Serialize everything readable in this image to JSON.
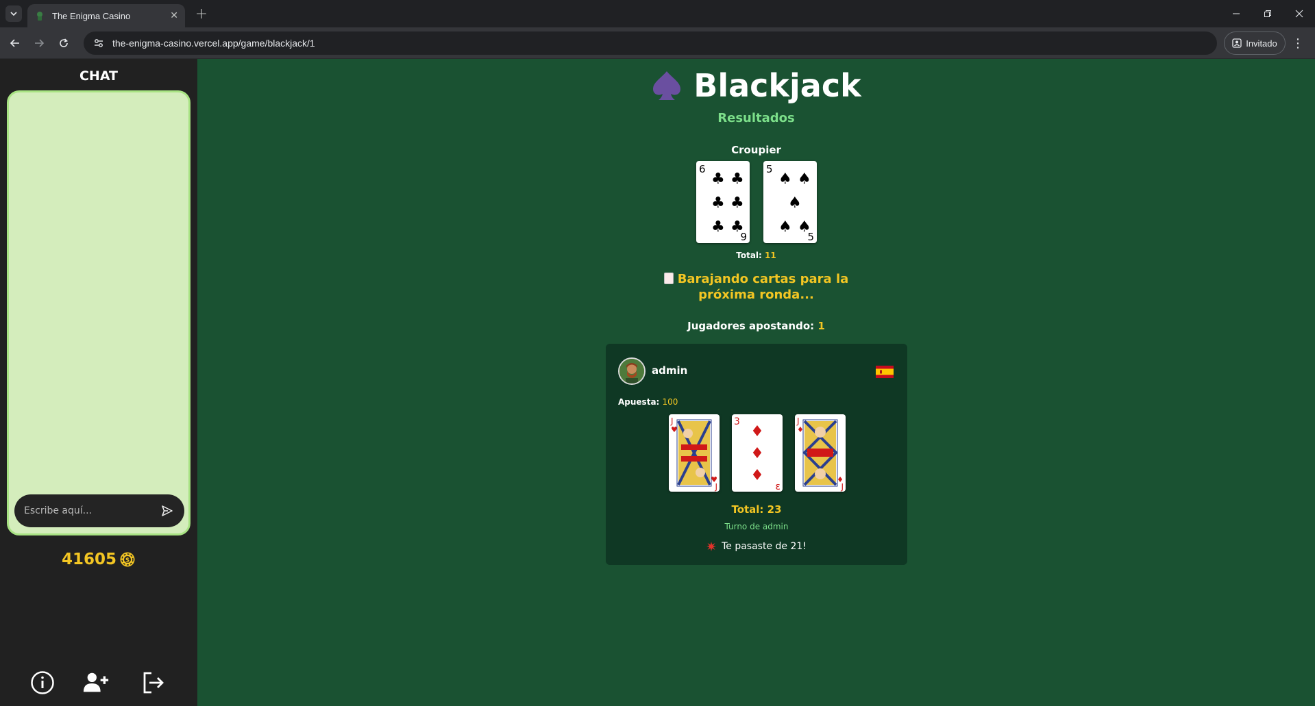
{
  "browser": {
    "tab_title": "The Enigma Casino",
    "url": "the-enigma-casino.vercel.app/game/blackjack/1",
    "profile_label": "Invitado"
  },
  "sidebar": {
    "chat_title": "CHAT",
    "chat_placeholder": "Escribe aquí...",
    "balance": "41605",
    "icons": [
      "info-icon",
      "add-friend-icon",
      "logout-icon"
    ]
  },
  "game": {
    "title": "Blackjack",
    "subtitle": "Resultados",
    "dealer_label": "Croupier",
    "dealer_cards": [
      {
        "rank": "6",
        "suit": "clubs"
      },
      {
        "rank": "5",
        "suit": "spades"
      }
    ],
    "dealer_total_label": "Total:",
    "dealer_total": "11",
    "shuffle_line1": "Barajando cartas para la",
    "shuffle_line2": "próxima ronda...",
    "players_betting_label": "Jugadores apostando:",
    "players_betting": "1"
  },
  "player": {
    "name": "admin",
    "bet_label": "Apuesta:",
    "bet": "100",
    "cards": [
      {
        "rank": "J",
        "suit": "hearts"
      },
      {
        "rank": "3",
        "suit": "diamonds"
      },
      {
        "rank": "J",
        "suit": "diamonds"
      }
    ],
    "total_text": "Total: 23",
    "turn_text": "Turno de admin",
    "bust_text": "Te pasaste de 21!"
  },
  "colors": {
    "page_bg": "#1a5232",
    "sidebar_bg": "#212121",
    "chat_bg": "#d4edbc",
    "accent_yellow": "#f3c623",
    "accent_green": "#7cdf8a",
    "panel_bg": "#0f3824"
  }
}
